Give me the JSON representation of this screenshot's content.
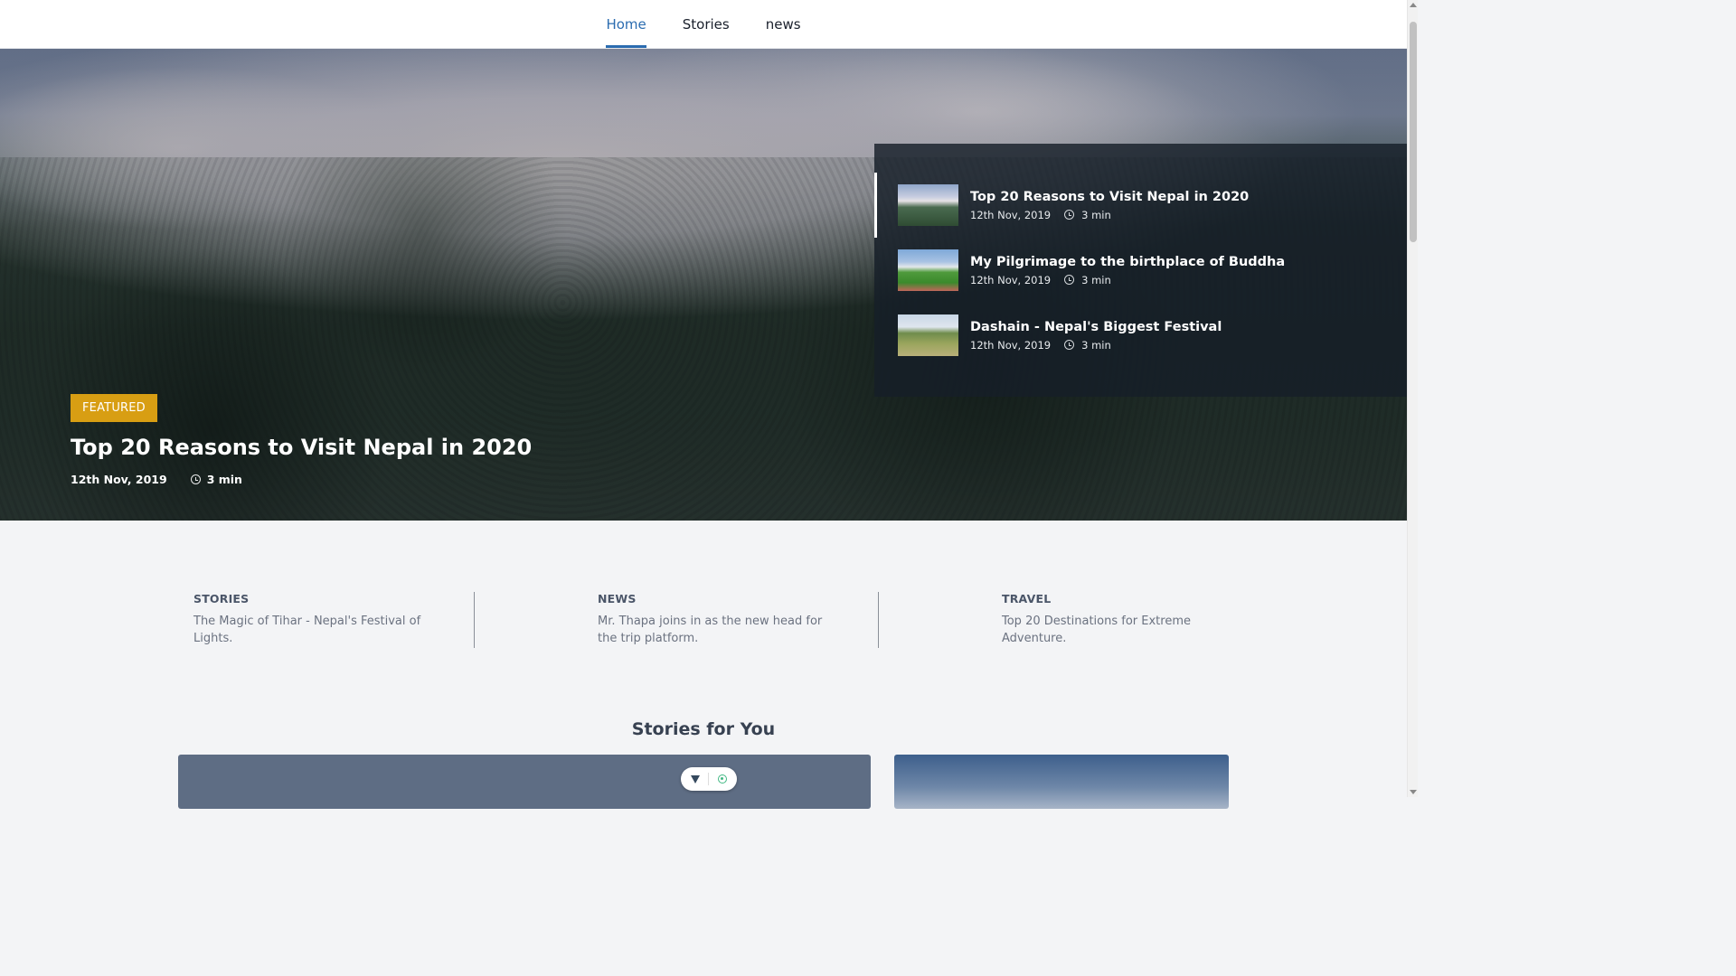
{
  "nav": {
    "items": [
      {
        "label": "Home",
        "active": true
      },
      {
        "label": "Stories",
        "active": false
      },
      {
        "label": "news",
        "active": false
      }
    ]
  },
  "hero": {
    "badge": "FEATURED",
    "title": "Top 20 Reasons to Visit Nepal in 2020",
    "date": "12th Nov, 2019",
    "read_time": "3 min"
  },
  "side_panel": {
    "items": [
      {
        "title": "Top 20 Reasons to Visit Nepal in 2020",
        "date": "12th Nov, 2019",
        "read_time": "3 min",
        "active": true
      },
      {
        "title": "My Pilgrimage to the birthplace of Buddha",
        "date": "12th Nov, 2019",
        "read_time": "3 min",
        "active": false
      },
      {
        "title": "Dashain - Nepal's Biggest Festival",
        "date": "12th Nov, 2019",
        "read_time": "3 min",
        "active": false
      }
    ]
  },
  "categories": [
    {
      "label": "STORIES",
      "description": "The Magic of Tihar - Nepal's Festival of Lights."
    },
    {
      "label": "NEWS",
      "description": "Mr. Thapa joins in as the new head for the trip platform."
    },
    {
      "label": "TRAVEL",
      "description": "Top 20 Destinations for Extreme Adventure."
    }
  ],
  "stories_section": {
    "title": "Stories for You"
  },
  "colors": {
    "accent": "#2b6cb0",
    "featured_badge": "#d89e13",
    "page_bg": "#f3f4f6"
  },
  "icons": {
    "clock": "clock-icon",
    "devtools": [
      "vue-icon",
      "target-icon"
    ]
  }
}
